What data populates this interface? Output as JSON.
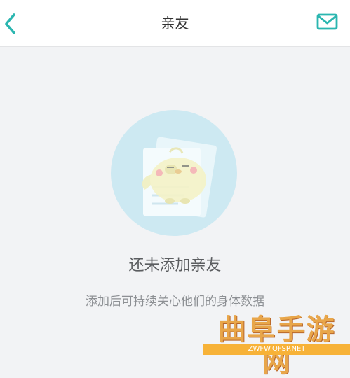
{
  "header": {
    "title": "亲友",
    "back_icon": "chevron-left-icon",
    "mail_icon": "mail-icon"
  },
  "empty_state": {
    "title": "还未添加亲友",
    "description": "添加后可持续关心他们的身体数据",
    "illustration": "bird-mascot-with-documents"
  },
  "watermark": {
    "text": "曲阜手游网",
    "url": "ZWFW.QFSP.NET"
  },
  "colors": {
    "accent": "#2bb6b0",
    "background": "#f2f3f5",
    "circle": "#cde9f2",
    "watermark_orange": "#f7b238"
  }
}
